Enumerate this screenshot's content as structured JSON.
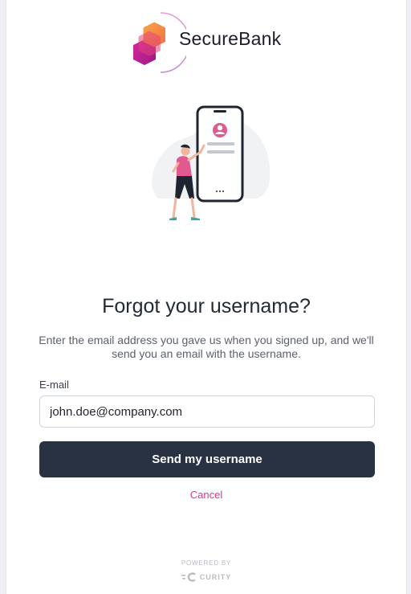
{
  "brand": {
    "name": "SecureBank",
    "colors": {
      "logo_orange": "#f58a2b",
      "logo_magenta": "#c2158b",
      "accent_pink": "#d63a8c",
      "button_dark": "#283242"
    }
  },
  "illustration": {
    "icon": "person-with-phone-illustration"
  },
  "form": {
    "title": "Forgot your username?",
    "description": "Enter the email address you gave us when you signed up, and we'll send you an email with the username.",
    "email_label": "E-mail",
    "email_value": "john.doe@company.com",
    "submit_label": "Send my username",
    "cancel_label": "Cancel"
  },
  "footer": {
    "powered_by": "POWERED BY",
    "provider": "CURITY",
    "provider_icon": "curity-logo-icon"
  }
}
